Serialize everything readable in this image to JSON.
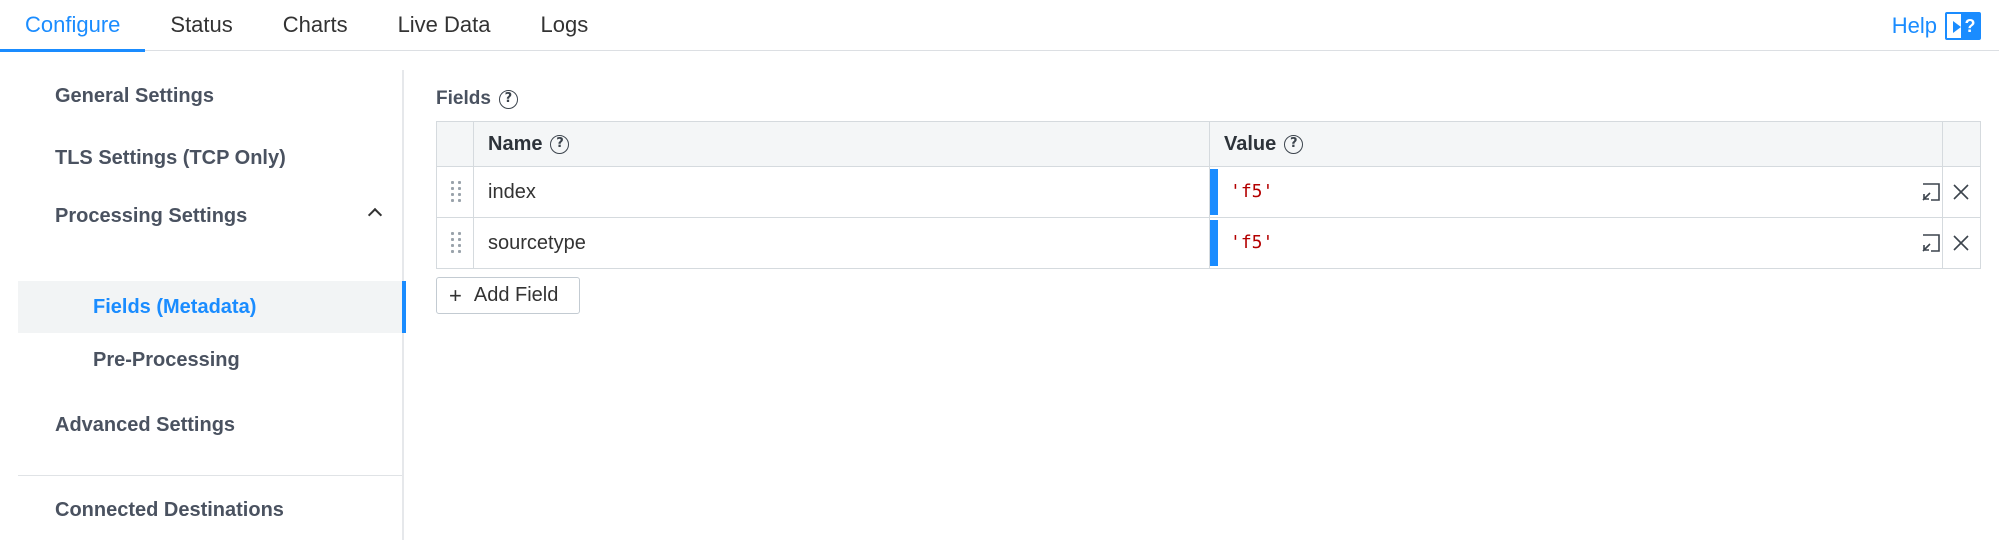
{
  "tabs": [
    {
      "label": "Configure",
      "active": true
    },
    {
      "label": "Status"
    },
    {
      "label": "Charts"
    },
    {
      "label": "Live Data"
    },
    {
      "label": "Logs"
    }
  ],
  "help": {
    "label": "Help"
  },
  "sidebar": {
    "items": [
      {
        "label": "General Settings"
      },
      {
        "label": "TLS Settings (TCP Only)"
      },
      {
        "label": "Processing Settings",
        "expanded": true
      },
      {
        "label": "Fields (Metadata)",
        "active": true
      },
      {
        "label": "Pre-Processing"
      },
      {
        "label": "Advanced Settings"
      },
      {
        "label": "Connected Destinations"
      }
    ]
  },
  "fields": {
    "label": "Fields",
    "columns": {
      "name": "Name",
      "value": "Value"
    },
    "rows": [
      {
        "name": "index",
        "value": "'f5'"
      },
      {
        "name": "sourcetype",
        "value": "'f5'"
      }
    ],
    "add_label": "Add Field"
  },
  "colors": {
    "accent": "#1a8cff",
    "value_text": "#b40000"
  }
}
